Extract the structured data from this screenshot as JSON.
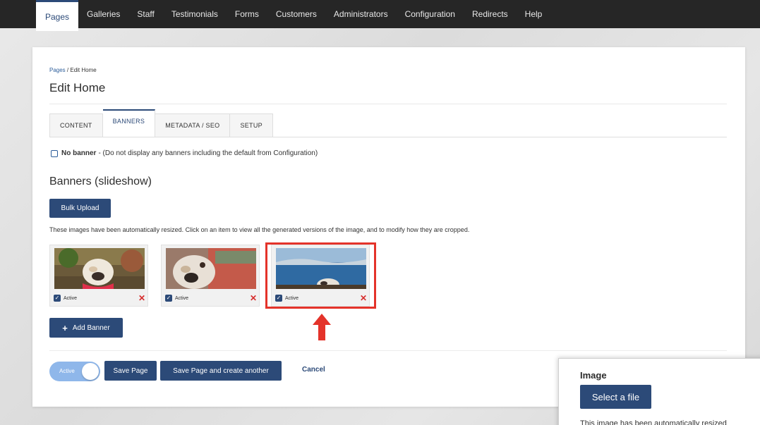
{
  "nav": {
    "items": [
      "Pages",
      "Galleries",
      "Staff",
      "Testimonials",
      "Forms",
      "Customers",
      "Administrators",
      "Configuration",
      "Redirects",
      "Help"
    ],
    "active": "Pages"
  },
  "breadcrumb": {
    "link": "Pages",
    "separator": " / ",
    "current": "Edit Home"
  },
  "page_title": "Edit Home",
  "tabs": [
    "CONTENT",
    "BANNERS",
    "METADATA / SEO",
    "SETUP"
  ],
  "active_tab": "BANNERS",
  "no_banner": {
    "label": "No banner",
    "note": " - (Do not display any banners including the default from Configuration)",
    "checked": false
  },
  "banners": {
    "title": "Banners (slideshow)",
    "bulk_upload_label": "Bulk Upload",
    "help_text": "These images have been automatically resized. Click on an item to view all the generated versions of the image, and to modify how they are cropped.",
    "items": [
      {
        "active_label": "Active",
        "checked": true
      },
      {
        "active_label": "Active",
        "checked": true
      },
      {
        "active_label": "Active",
        "checked": true
      }
    ],
    "add_banner_label": "Add Banner"
  },
  "footer": {
    "toggle_label": "Active",
    "save_label": "Save Page",
    "save_another_label": "Save Page and create another",
    "cancel_label": "Cancel"
  },
  "image_panel": {
    "label": "Image",
    "select_label": "Select a file",
    "text": "This image has been automatically resized"
  },
  "colors": {
    "nav_bg": "#262626",
    "primary": "#2c4a78",
    "highlight": "#e4332a",
    "remove": "#d62c2c",
    "toggle": "#8fb7ea"
  }
}
